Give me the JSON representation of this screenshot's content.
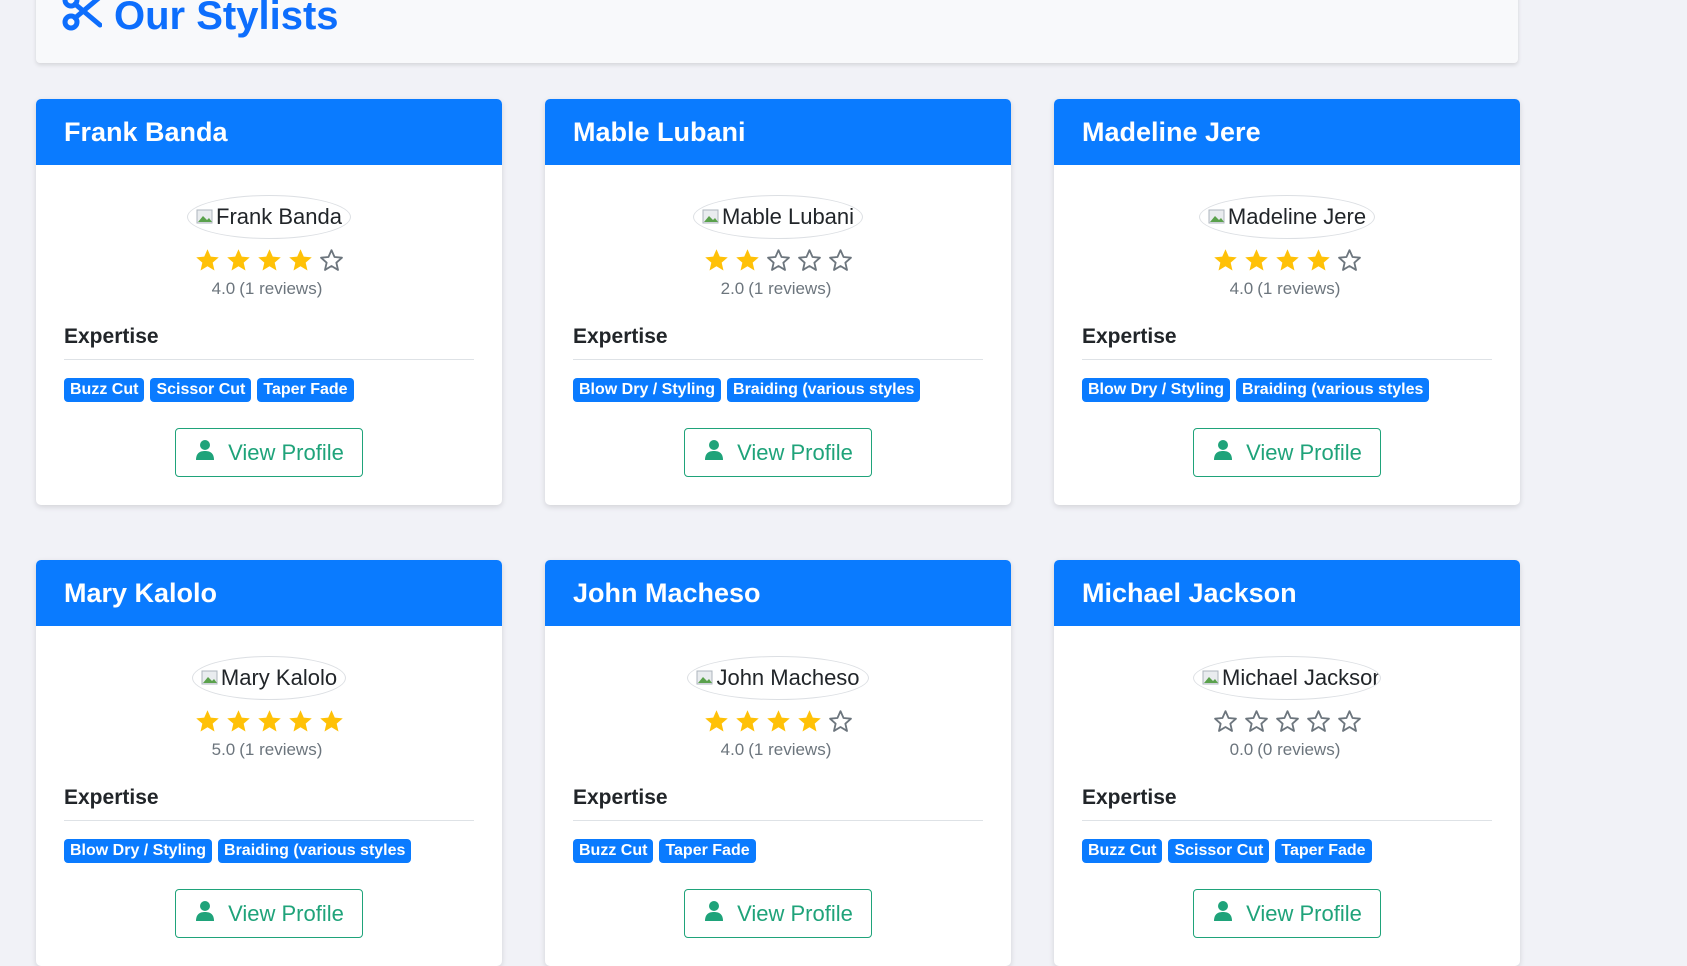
{
  "page": {
    "title": "Our Stylists",
    "title_icon": "scissors-icon"
  },
  "colors": {
    "primary": "#0a7bff",
    "star": "#ffc107",
    "star_empty": "#6c757d",
    "button": "#1fa37a",
    "background": "#f1f2f7"
  },
  "labels": {
    "expertise": "Expertise",
    "view_profile": "View Profile"
  },
  "stylists": [
    {
      "name": "Frank Banda",
      "avatar_alt": "Frank Banda",
      "rating": 4,
      "rating_text": "4.0",
      "reviews_text": "(1 reviews)",
      "expertise": [
        "Buzz Cut",
        "Scissor Cut",
        "Taper Fade"
      ]
    },
    {
      "name": "Mable Lubani",
      "avatar_alt": "Mable Lubani",
      "rating": 2,
      "rating_text": "2.0",
      "reviews_text": "(1 reviews)",
      "expertise": [
        "Blow Dry / Styling",
        "Braiding (various styles"
      ]
    },
    {
      "name": "Madeline Jere",
      "avatar_alt": "Madeline Jere",
      "rating": 4,
      "rating_text": "4.0",
      "reviews_text": "(1 reviews)",
      "expertise": [
        "Blow Dry / Styling",
        "Braiding (various styles"
      ]
    },
    {
      "name": "Mary Kalolo",
      "avatar_alt": "Mary Kalolo",
      "rating": 5,
      "rating_text": "5.0",
      "reviews_text": "(1 reviews)",
      "expertise": [
        "Blow Dry / Styling",
        "Braiding (various styles"
      ]
    },
    {
      "name": "John Macheso",
      "avatar_alt": "John Macheso",
      "rating": 4,
      "rating_text": "4.0",
      "reviews_text": "(1 reviews)",
      "expertise": [
        "Buzz Cut",
        "Taper Fade"
      ]
    },
    {
      "name": "Michael Jackson",
      "avatar_alt": "Michael Jackson",
      "rating": 0,
      "rating_text": "0.0",
      "reviews_text": "(0 reviews)",
      "expertise": [
        "Buzz Cut",
        "Scissor Cut",
        "Taper Fade"
      ]
    }
  ]
}
